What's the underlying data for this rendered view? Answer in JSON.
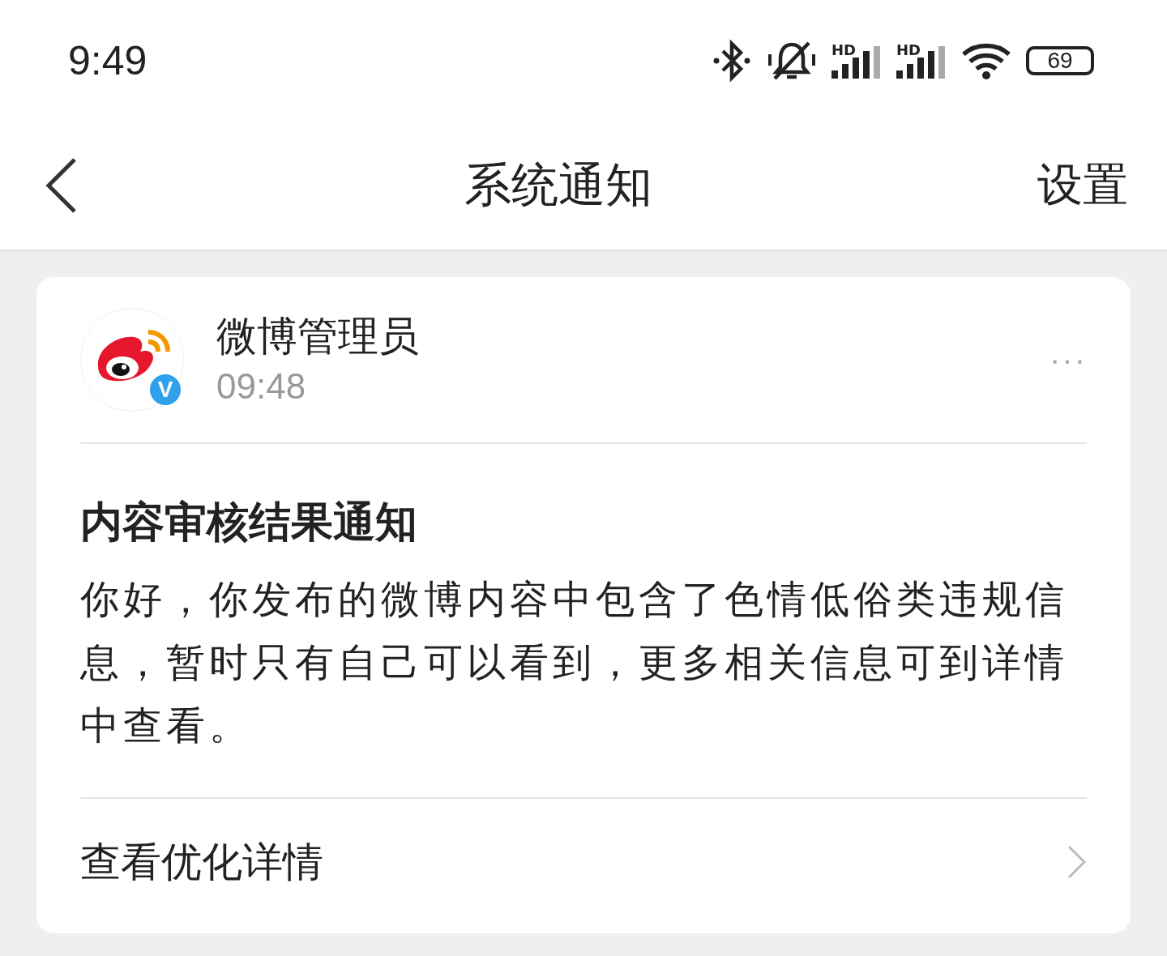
{
  "status_bar": {
    "time": "9:49",
    "signals": [
      {
        "label": "HD"
      },
      {
        "label": "HD"
      }
    ],
    "battery": "69"
  },
  "nav": {
    "title": "系统通知",
    "action": "设置"
  },
  "notice": {
    "sender": "微博管理员",
    "verified_badge": "V",
    "time": "09:48",
    "menu": "···",
    "title": "内容审核结果通知",
    "body": "你好，你发布的微博内容中包含了色情低俗类违规信息，暂时只有自己可以看到，更多相关信息可到详情中查看。",
    "link": "查看优化详情"
  }
}
